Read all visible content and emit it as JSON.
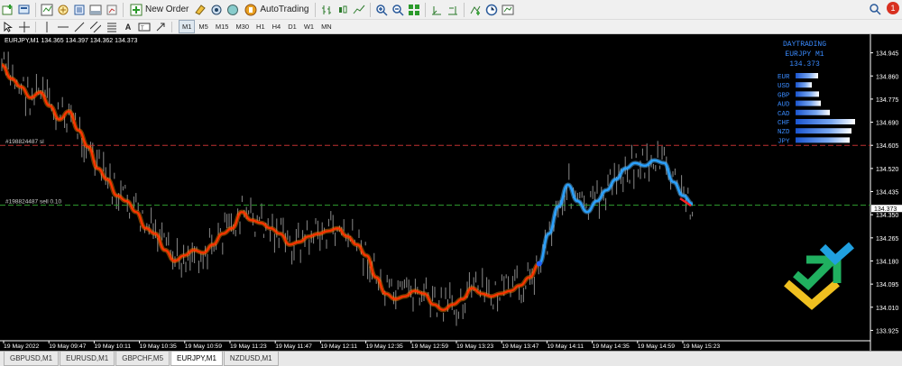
{
  "toolbar": {
    "new_order_label": "New Order",
    "autotrading_label": "AutoTrading",
    "notification_count": "1",
    "timeframes": [
      "M1",
      "M5",
      "M15",
      "M30",
      "H1",
      "H4",
      "D1",
      "W1",
      "MN"
    ],
    "active_timeframe": "M1"
  },
  "chart": {
    "header": "EURJPY,M1  134.365 134.397 134.362 134.373",
    "price_labels": [
      "134.945",
      "134.860",
      "134.775",
      "134.690",
      "134.605",
      "134.520",
      "134.435",
      "134.350",
      "134.265",
      "134.180",
      "134.095",
      "134.010",
      "133.925"
    ],
    "current_price": "134.373",
    "time_labels": [
      "19 May 2022",
      "19 May 09:47",
      "19 May 10:11",
      "19 May 10:35",
      "19 May 10:59",
      "19 May 11:23",
      "19 May 11:47",
      "19 May 12:11",
      "19 May 12:35",
      "19 May 12:59",
      "19 May 13:23",
      "19 May 13:47",
      "19 May 14:11",
      "19 May 14:35",
      "19 May 14:59",
      "19 May 15:23"
    ],
    "sl_label": "#198824487 sl",
    "sell_label": "#198824487 sell 0.10",
    "sl_price": 134.605,
    "entry_price": 134.385,
    "colors": {
      "down_line": "#ff3300",
      "up_line": "#2aa0ff",
      "sl_line": "#c03030",
      "entry_line": "#30a030",
      "candles": "#8a8a8a"
    }
  },
  "chart_data": {
    "type": "line",
    "title": "EURJPY,M1",
    "ylim": [
      133.9,
      135.0
    ],
    "series": [
      {
        "values": [
          134.9,
          134.85,
          134.82,
          134.78,
          134.8,
          134.75,
          134.7,
          134.73,
          134.66,
          134.6,
          134.52,
          134.48,
          134.42,
          134.4,
          134.36,
          134.3,
          134.28,
          134.22,
          134.18,
          134.2,
          134.22,
          134.21,
          134.24,
          134.28,
          134.3,
          134.36,
          134.33,
          134.32,
          134.3,
          134.28,
          134.24,
          134.25,
          134.27,
          134.28,
          134.29,
          134.3,
          134.27,
          134.24,
          134.2,
          134.12,
          134.06,
          134.04,
          134.05,
          134.07,
          134.06,
          134.02,
          134.0,
          134.02,
          134.04,
          134.08,
          134.06,
          134.05,
          134.06,
          134.07,
          134.09,
          134.12,
          134.17
        ],
        "color": "#ff3300"
      },
      {
        "values": [
          134.17,
          134.28,
          134.38,
          134.46,
          134.4,
          134.36,
          134.4,
          134.44,
          134.48,
          134.52,
          134.54,
          134.53,
          134.55,
          134.54,
          134.47,
          134.42,
          134.39
        ],
        "color": "#2aa0ff"
      }
    ]
  },
  "indicator_panel": {
    "title": "DAYTRADING",
    "symbol_line": "EURJPY M1",
    "price": "134.373",
    "currencies": [
      {
        "name": "EUR",
        "strength": 0.38
      },
      {
        "name": "USD",
        "strength": 0.28
      },
      {
        "name": "GBP",
        "strength": 0.4
      },
      {
        "name": "AUD",
        "strength": 0.43
      },
      {
        "name": "CAD",
        "strength": 0.58
      },
      {
        "name": "CHF",
        "strength": 1.0
      },
      {
        "name": "NZD",
        "strength": 0.94
      },
      {
        "name": "JPY",
        "strength": 0.91
      }
    ]
  },
  "tabs": [
    {
      "label": "GBPUSD,M1",
      "active": false
    },
    {
      "label": "EURUSD,M1",
      "active": false
    },
    {
      "label": "GBPCHF,M5",
      "active": false
    },
    {
      "label": "EURJPY,M1",
      "active": true
    },
    {
      "label": "NZDUSD,M1",
      "active": false
    }
  ]
}
